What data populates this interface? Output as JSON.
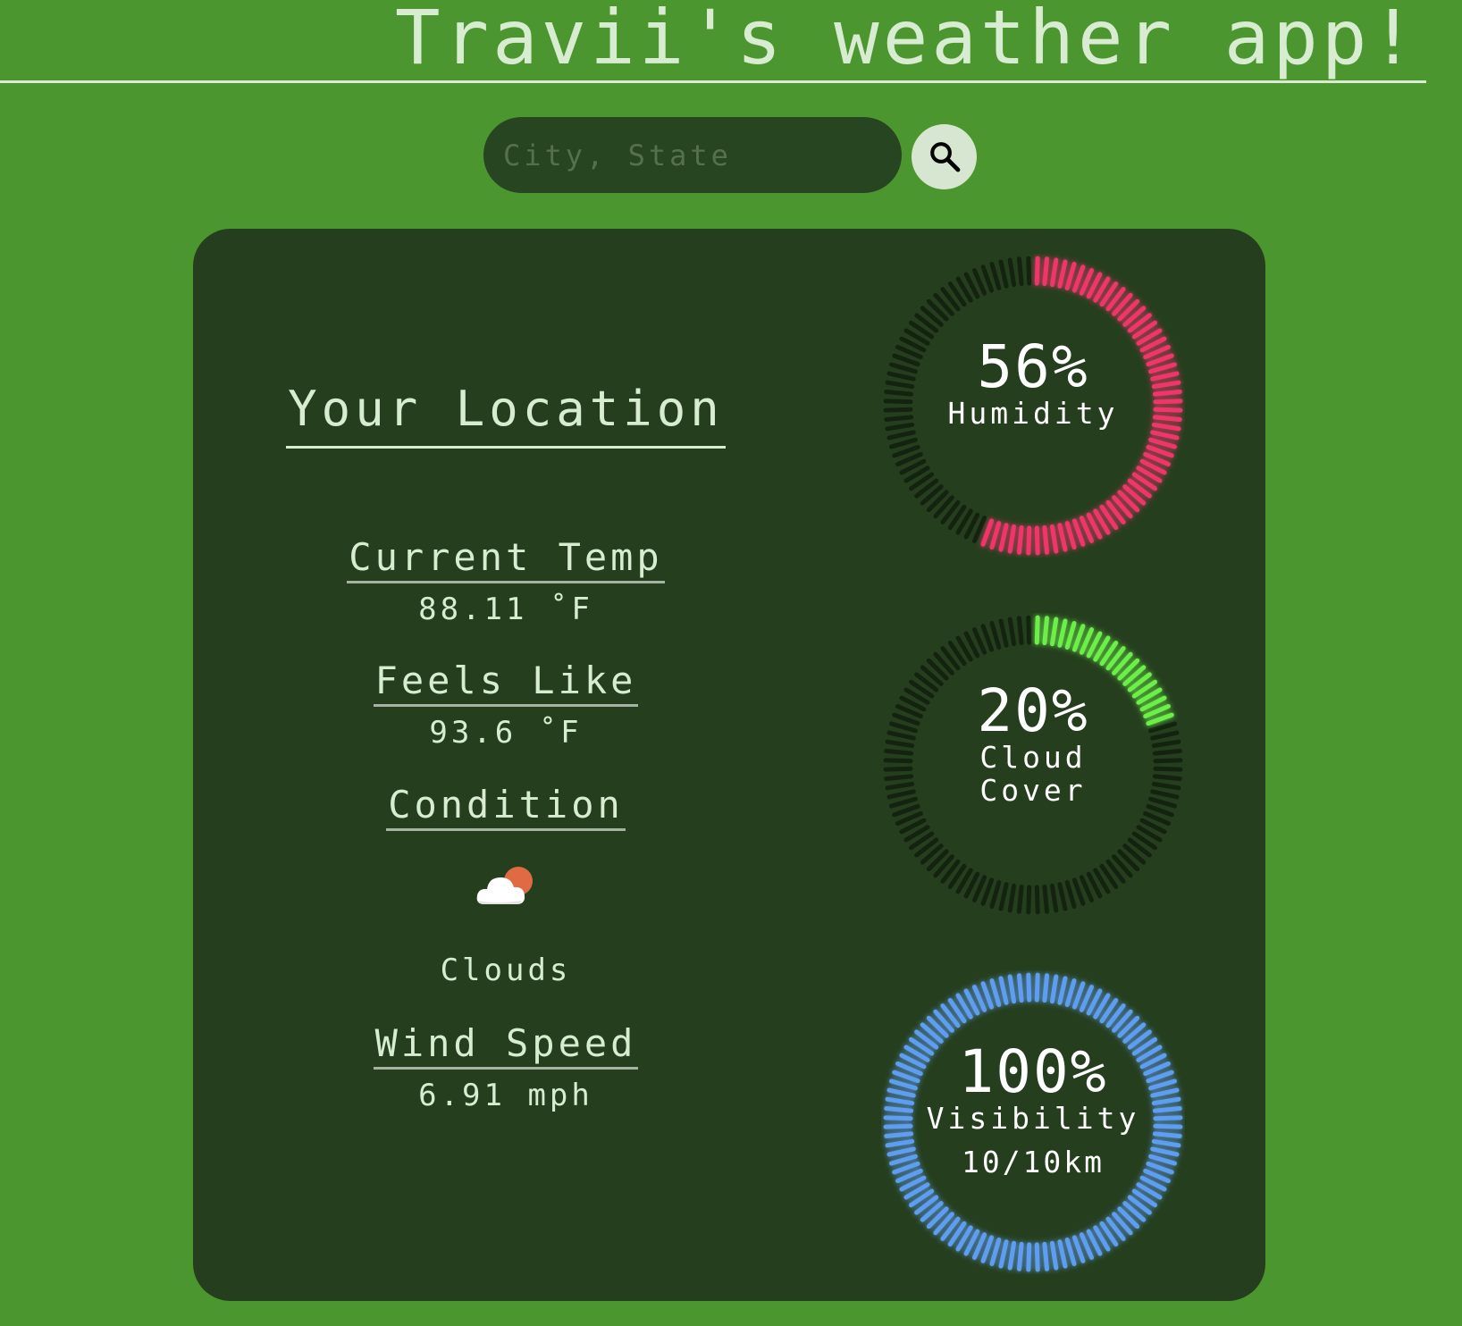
{
  "app": {
    "title": "Travii's weather app!"
  },
  "search": {
    "placeholder": "City, State",
    "value": "",
    "button_icon": "search-icon"
  },
  "location": {
    "title": "Your Location"
  },
  "stats": {
    "current_temp": {
      "label": "Current Temp",
      "value": "88.11 ˚F"
    },
    "feels_like": {
      "label": "Feels Like",
      "value": "93.6 ˚F"
    },
    "condition": {
      "label": "Condition",
      "icon": "cloud-sun-icon",
      "text": "Clouds"
    },
    "wind_speed": {
      "label": "Wind Speed",
      "value": "6.91 mph"
    }
  },
  "gauges": {
    "humidity": {
      "value_text": "56%",
      "label": "Humidity",
      "fraction": 0.56,
      "color": "#f0356b"
    },
    "cloud_cover": {
      "value_text": "20%",
      "label_line1": "Cloud",
      "label_line2": "Cover",
      "fraction": 0.2,
      "color": "#6cf04a"
    },
    "visibility": {
      "value_text": "100%",
      "label": "Visibility",
      "sub": "10/10km",
      "fraction": 1.0,
      "color": "#5e9df0"
    }
  },
  "colors": {
    "page_background": "#4c962f",
    "card_background": "#253f1e",
    "text": "#d7ecd0",
    "gauge_track": "#13230f"
  }
}
